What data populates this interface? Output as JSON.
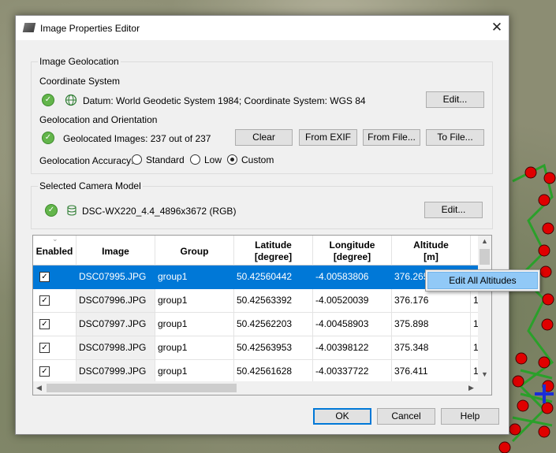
{
  "dialog": {
    "title": "Image Properties Editor",
    "close_glyph": "✕"
  },
  "geolocation": {
    "group_title": "Image Geolocation",
    "coord_heading": "Coordinate System",
    "coord_text": "Datum: World Geodetic System 1984; Coordinate System: WGS 84",
    "coord_edit": "Edit...",
    "geo_heading": "Geolocation and Orientation",
    "geo_status": "Geolocated Images: 237 out of 237",
    "buttons": {
      "clear": "Clear",
      "from_exif": "From EXIF",
      "from_file": "From File...",
      "to_file": "To File..."
    },
    "accuracy_label": "Geolocation Accuracy:",
    "accuracy_options": [
      "Standard",
      "Low",
      "Custom"
    ],
    "accuracy_selected": "Custom"
  },
  "camera": {
    "group_title": "Selected Camera Model",
    "model_text": "DSC-WX220_4.4_4896x3672 (RGB)",
    "edit": "Edit..."
  },
  "table": {
    "headers": {
      "enabled": "Enabled",
      "image": "Image",
      "group": "Group",
      "latitude": "Latitude\n[degree]",
      "longitude": "Longitude\n[degree]",
      "altitude": "Altitude\n[m]"
    },
    "rows": [
      {
        "image": "DSC07995.JPG",
        "group": "group1",
        "lat": "50.42560442",
        "lon": "-4.00583806",
        "alt": "376.265",
        "extra": ""
      },
      {
        "image": "DSC07996.JPG",
        "group": "group1",
        "lat": "50.42563392",
        "lon": "-4.00520039",
        "alt": "376.176",
        "extra": "1"
      },
      {
        "image": "DSC07997.JPG",
        "group": "group1",
        "lat": "50.42562203",
        "lon": "-4.00458903",
        "alt": "375.898",
        "extra": "1"
      },
      {
        "image": "DSC07998.JPG",
        "group": "group1",
        "lat": "50.42563953",
        "lon": "-4.00398122",
        "alt": "375.348",
        "extra": "1"
      },
      {
        "image": "DSC07999.JPG",
        "group": "group1",
        "lat": "50.42561628",
        "lon": "-4.00337722",
        "alt": "376.411",
        "extra": "1"
      }
    ],
    "selected_row": 0
  },
  "context_menu": {
    "item": "Edit All Altitudes"
  },
  "footer": {
    "ok": "OK",
    "cancel": "Cancel",
    "help": "Help"
  },
  "icons": {
    "check": "check-circle-icon",
    "globe": "globe-icon",
    "database": "database-icon"
  },
  "colors": {
    "selection": "#0078d7",
    "status_green": "#63b54b",
    "menu_highlight": "#91c9f7"
  }
}
